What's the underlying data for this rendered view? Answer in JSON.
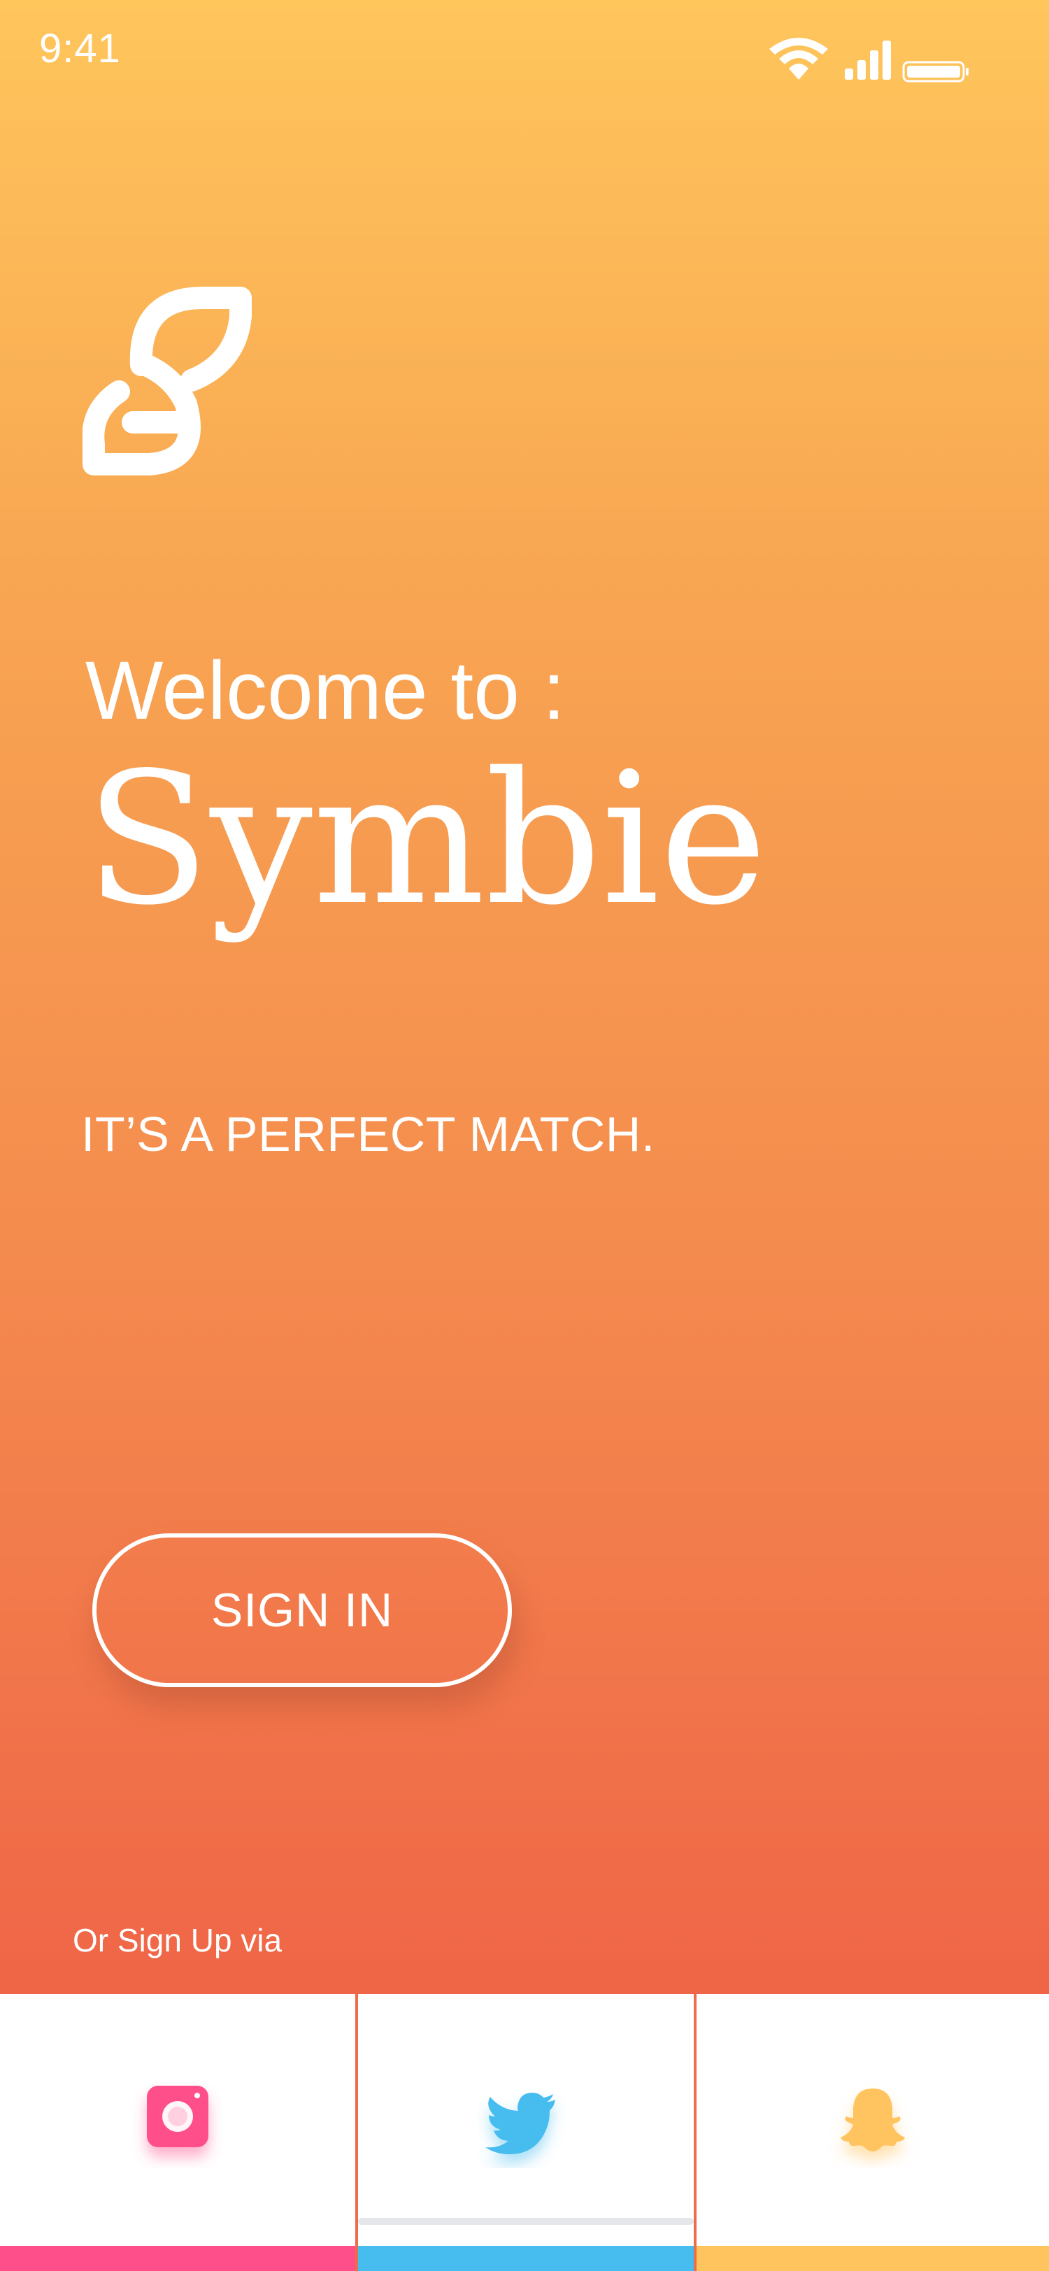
{
  "status_bar": {
    "time": "9:41"
  },
  "icons": {
    "wifi": "wifi-icon",
    "cellular": "cellular-signal-icon",
    "battery": "battery-icon",
    "logo": "symbie-logo-icon",
    "instagram": "instagram-icon",
    "twitter": "twitter-icon",
    "snapchat": "snapchat-icon"
  },
  "hero": {
    "welcome_text": "Welcome to :",
    "brand_name": "Symbie",
    "tagline": "IT’S A PERFECT MATCH."
  },
  "actions": {
    "sign_in_label": "SIGN IN",
    "sign_up_label": "Or Sign Up via"
  },
  "colors": {
    "gradient_top": "#FFC65C",
    "gradient_bottom": "#EE6346",
    "instagram": "#FF4F8A",
    "twitter": "#46BCEF",
    "snapchat": "#FFC45E"
  }
}
